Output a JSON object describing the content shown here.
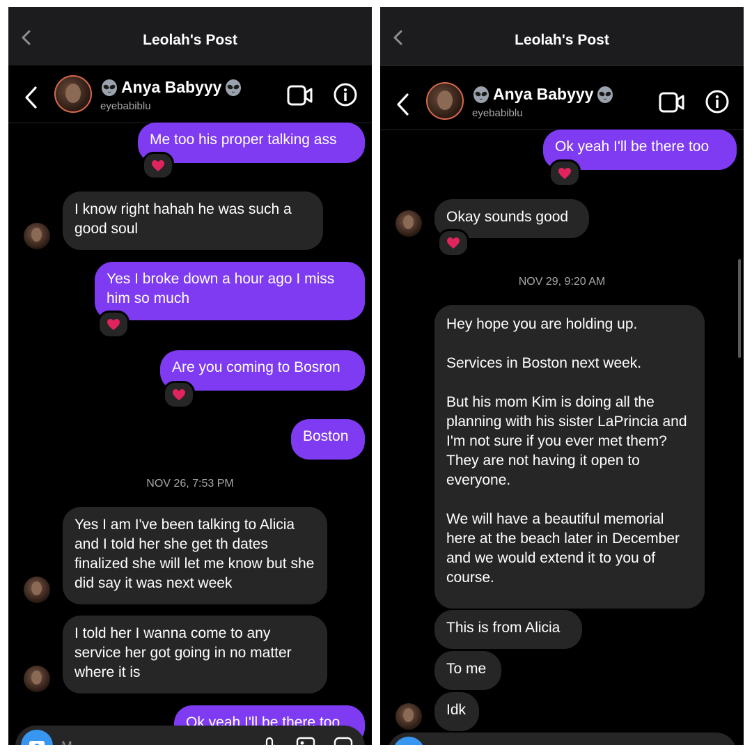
{
  "colors": {
    "outgoing_bubble": "#7e3bf2",
    "incoming_bubble": "#262626",
    "background": "#000000",
    "header": "#1c1c1e",
    "camera_button": "#3797f0",
    "reaction": "#e0245e"
  },
  "left": {
    "post_title": "Leolah's Post",
    "chat": {
      "name": "Anya Babyyy",
      "username": "eyebabiblu"
    },
    "messages": [
      {
        "text": "Me too his proper talking ass",
        "reaction": "red-heart"
      },
      {
        "text": "I know right hahah he was such a good soul"
      },
      {
        "text": "Yes I broke down a hour ago I miss him so much",
        "reaction": "red-heart"
      },
      {
        "text": "Are you coming to Bosron",
        "reaction": "red-heart"
      },
      {
        "text": "Boston"
      },
      {
        "text": "Yes I am I've been talking to Alicia and I told her she get th dates finalized she will let me know but she did say it was next week"
      },
      {
        "text": "I told her I wanna come to any service her got going in no matter where it is"
      },
      {
        "text": "Ok yeah I'll be there too"
      }
    ],
    "timestamp": "NOV 26, 7:53 PM",
    "composer_placeholder": "M..."
  },
  "right": {
    "post_title": "Leolah's Post",
    "chat": {
      "name": "Anya Babyyy",
      "username": "eyebabiblu"
    },
    "messages": [
      {
        "text": "Ok yeah I'll be there too",
        "reaction": "red-heart"
      },
      {
        "text": "Okay sounds good",
        "reaction": "red-heart"
      },
      {
        "text": "Hey hope you are holding up.\n\nServices in Boston next week.\n\nBut his mom Kim is doing all the planning with his sister LaPrincia and I'm not sure if you  ever met them? They are not having it open to everyone.\n\nWe will have a beautiful memorial here at the beach later in December and we would  extend it to you of course."
      },
      {
        "text": "This is from Alicia"
      },
      {
        "text": "To me"
      },
      {
        "text": "Idk"
      }
    ],
    "timestamp": "NOV 29, 9:20 AM"
  },
  "icons": [
    "chevron-left-icon",
    "back-arrow-icon",
    "video-call-icon",
    "info-icon",
    "alien-emoji-icon",
    "red-heart-icon",
    "camera-icon",
    "microphone-icon",
    "gallery-icon",
    "sticker-icon"
  ]
}
